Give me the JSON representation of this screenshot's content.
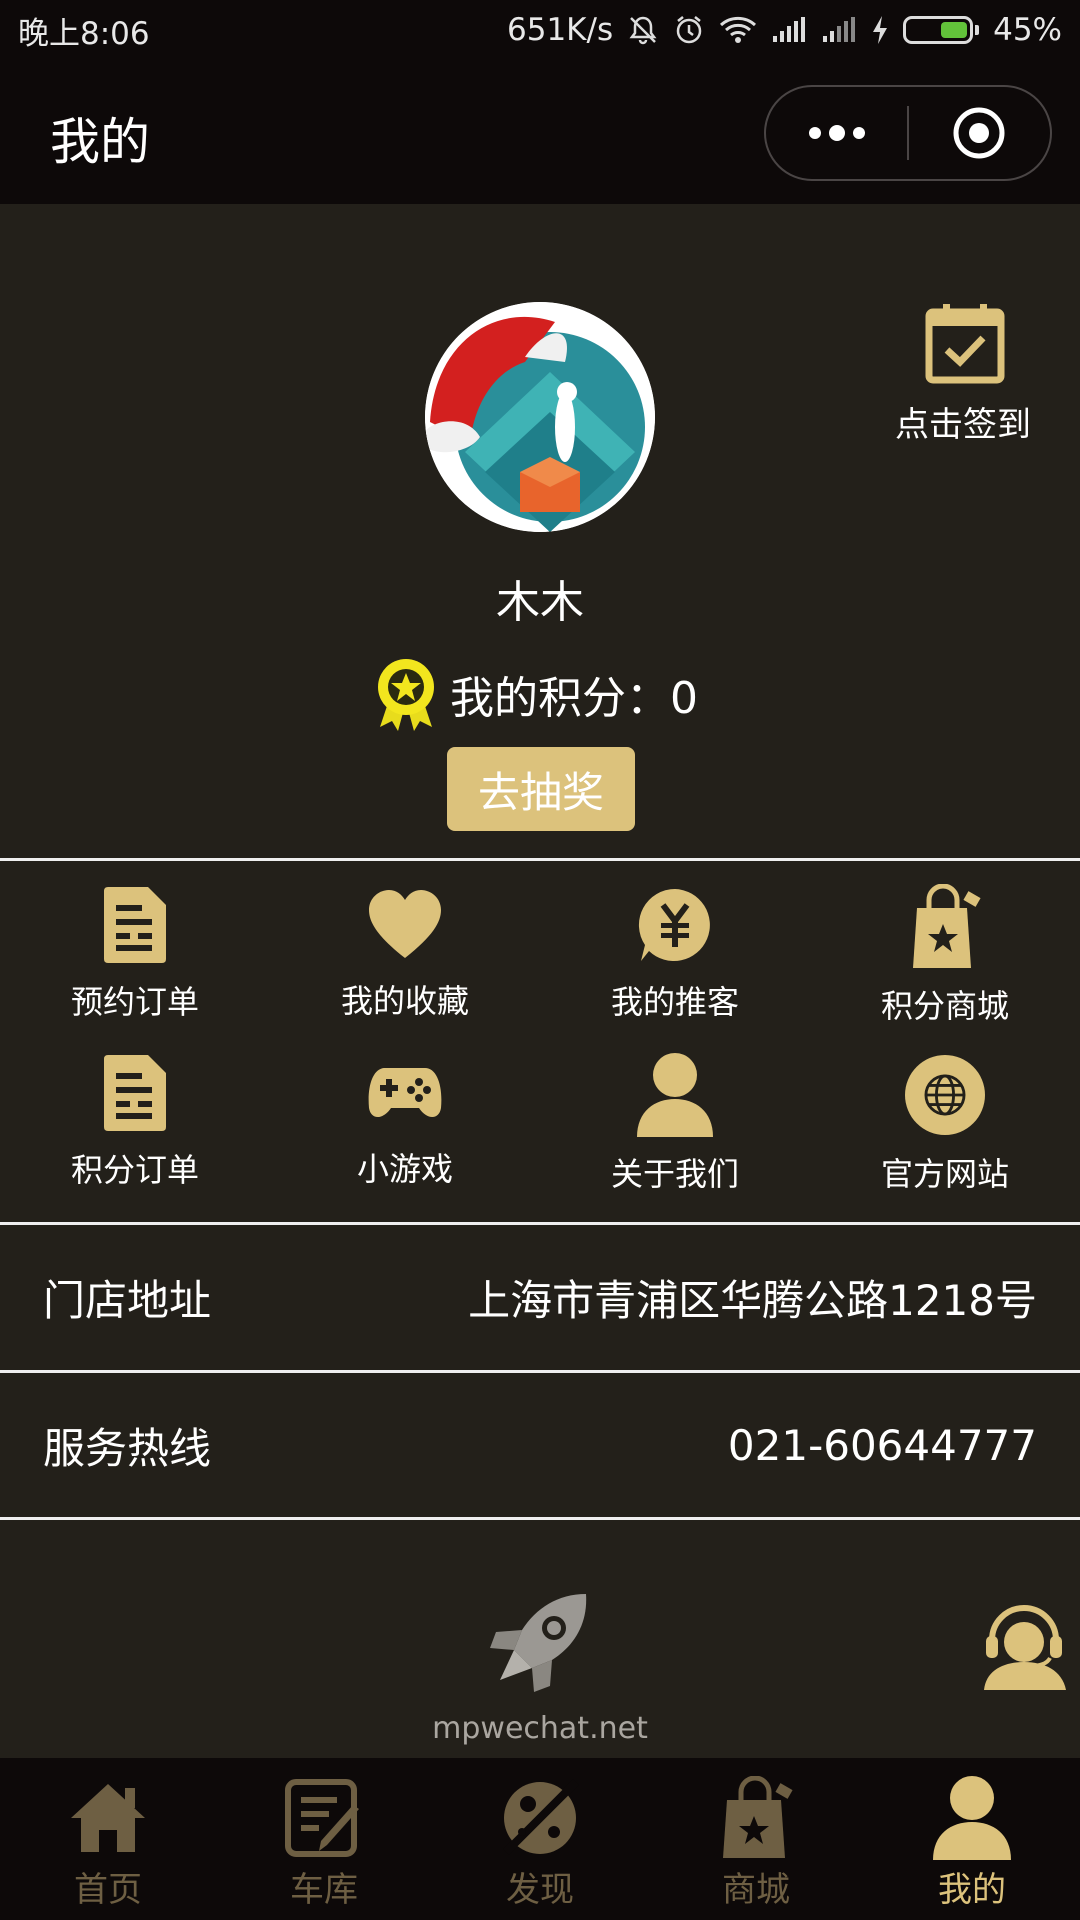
{
  "status_bar": {
    "time": "晚上8:06",
    "net_speed": "651K/s",
    "battery_percent": "45%",
    "battery_level": 0.45
  },
  "header": {
    "title": "我的"
  },
  "profile": {
    "nickname": "木木",
    "points_label": "我的积分：0",
    "lottery_button": "去抽奖",
    "signin_label": "点击签到"
  },
  "menu": [
    {
      "label": "预约订单",
      "icon": "document-icon"
    },
    {
      "label": "我的收藏",
      "icon": "heart-icon"
    },
    {
      "label": "我的推客",
      "icon": "yuan-bubble-icon"
    },
    {
      "label": "积分商城",
      "icon": "shopping-bag-icon"
    },
    {
      "label": "积分订单",
      "icon": "document-icon"
    },
    {
      "label": "小游戏",
      "icon": "gamepad-icon"
    },
    {
      "label": "关于我们",
      "icon": "person-icon"
    },
    {
      "label": "官方网站",
      "icon": "globe-icon"
    }
  ],
  "info": {
    "address_label": "门店地址",
    "address_value": "上海市青浦区华腾公路1218号",
    "hotline_label": "服务热线",
    "hotline_value": "021-60644777"
  },
  "brand": {
    "text": "mpwechat.net"
  },
  "tabs": [
    {
      "label": "首页",
      "icon": "home-icon"
    },
    {
      "label": "车库",
      "icon": "edit-note-icon"
    },
    {
      "label": "发现",
      "icon": "planet-icon"
    },
    {
      "label": "商城",
      "icon": "shopping-bag-icon"
    },
    {
      "label": "我的",
      "icon": "person-icon",
      "active": true
    }
  ],
  "colors": {
    "accent": "#dcc27c",
    "background": "#23201a",
    "bar_background": "#0d0909",
    "tab_inactive": "#6e5f43"
  }
}
